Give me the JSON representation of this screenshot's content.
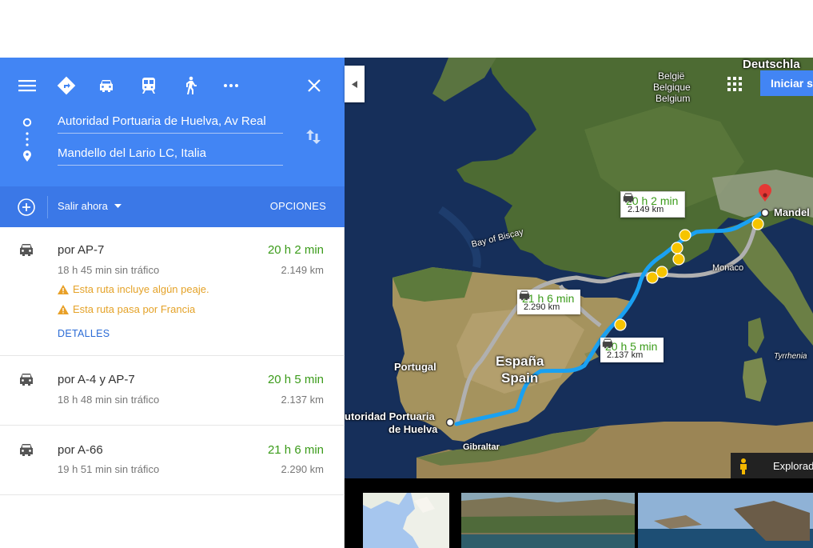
{
  "modes": [
    {
      "name": "menu-icon"
    },
    {
      "name": "directions-icon"
    },
    {
      "name": "car-icon"
    },
    {
      "name": "transit-icon"
    },
    {
      "name": "walk-icon"
    },
    {
      "name": "more-icon"
    },
    {
      "name": "close-icon"
    }
  ],
  "inputs": {
    "origin": "Autoridad Portuaria de Huelva, Av Real",
    "destination": "Mandello del Lario LC, Italia"
  },
  "subbar": {
    "depart": "Salir ahora",
    "options": "OPCIONES"
  },
  "routes": [
    {
      "name": "por AP-7",
      "time": "20 h 2 min",
      "traffic": "18 h 45 min sin tráfico",
      "distance": "2.149 km",
      "warnings": [
        "Esta ruta incluye algún peaje.",
        "Esta ruta pasa por Francia"
      ],
      "details": "DETALLES"
    },
    {
      "name": "por A-4 y AP-7",
      "time": "20 h 5 min",
      "traffic": "18 h 48 min sin tráfico",
      "distance": "2.137 km"
    },
    {
      "name": "por A-66",
      "time": "21 h 6 min",
      "traffic": "19 h 51 min sin tráfico",
      "distance": "2.290 km"
    }
  ],
  "map": {
    "iniciar": "Iniciar s",
    "labels": {
      "deutschland": "Deutschla",
      "belgie": "België",
      "belgique": "Belgique",
      "belgium": "Belgium",
      "bay": "Bay of Biscay",
      "monaco": "Monaco",
      "portugal": "Portugal",
      "espana": "España",
      "spain": "Spain",
      "origin1": "utoridad Portuaria",
      "origin2": "de Huelva",
      "gibraltar": "Gibraltar",
      "mandello": "Mandel",
      "tyrrhenian": "Tyrrhenia"
    },
    "bubbles": [
      {
        "time": "20 h 2 min",
        "dist": "2.149 km"
      },
      {
        "time": "21 h 6 min",
        "dist": "2.290 km"
      },
      {
        "time": "20 h 5 min",
        "dist": "2.137 km"
      }
    ],
    "explore": "Explorad"
  },
  "colors": {
    "header": "#4285f4",
    "subbar": "#3b78e7",
    "time": "#3b9b1a",
    "warning": "#e4a228",
    "route": "#19a0f0",
    "alt_route": "#a9a9a9"
  }
}
